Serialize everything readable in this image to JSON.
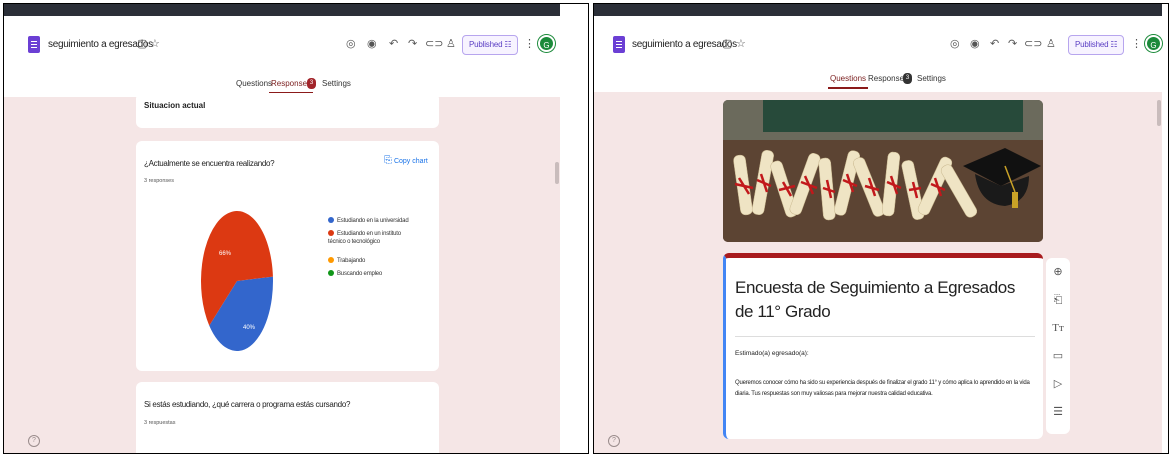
{
  "left": {
    "doc_title": "seguimiento a egresados",
    "publish_label": "Published",
    "avatar_letter": "G",
    "tabs": [
      {
        "label": "Questions"
      },
      {
        "label": "Responses"
      },
      {
        "label": "Settings"
      }
    ],
    "responses_badge": "3",
    "section_title": "Situacion actual",
    "question1": {
      "title": "¿Actualmente se encuentra realizando?",
      "responses": "3 responses",
      "copy_chart": "Copy chart",
      "slice_labels": [
        "66%",
        "40%"
      ]
    },
    "question2": {
      "title": "Si estás estudiando, ¿qué carrera o programa estás cursando?",
      "responses": "3 respuestas"
    }
  },
  "right": {
    "doc_title": "seguimiento a egresados",
    "publish_label": "Published",
    "avatar_letter": "G",
    "tabs": [
      {
        "label": "Questions"
      },
      {
        "label": "Responses"
      },
      {
        "label": "Settings"
      }
    ],
    "responses_badge": "3",
    "form_title": "Encuesta de Seguimiento a Egresados de 11° Grado",
    "greeting": "Estimado(a) egresado(a):",
    "description": "Queremos conocer cómo ha sido su experiencia después de finalizar el grado 11° y cómo aplica lo aprendido en la vida diaria. Tus respuestas son muy valiosas para mejorar nuestra calidad educativa."
  },
  "chart_data": {
    "type": "pie",
    "title": "¿Actualmente se encuentra realizando?",
    "categories": [
      "Estudiando en la universidad",
      "Estudiando en un instituto técnico o tecnológico",
      "Trabajando",
      "Buscando empleo"
    ],
    "values": [
      40,
      60,
      0,
      0
    ],
    "colors": [
      "#3366cc",
      "#dc3912",
      "#ff9900",
      "#109618"
    ],
    "legend_position": "right"
  },
  "colors": {
    "brand_purple": "#6b3fd4",
    "accent_red": "#8b1a1a",
    "canvas_pink": "#f5e6e6"
  }
}
